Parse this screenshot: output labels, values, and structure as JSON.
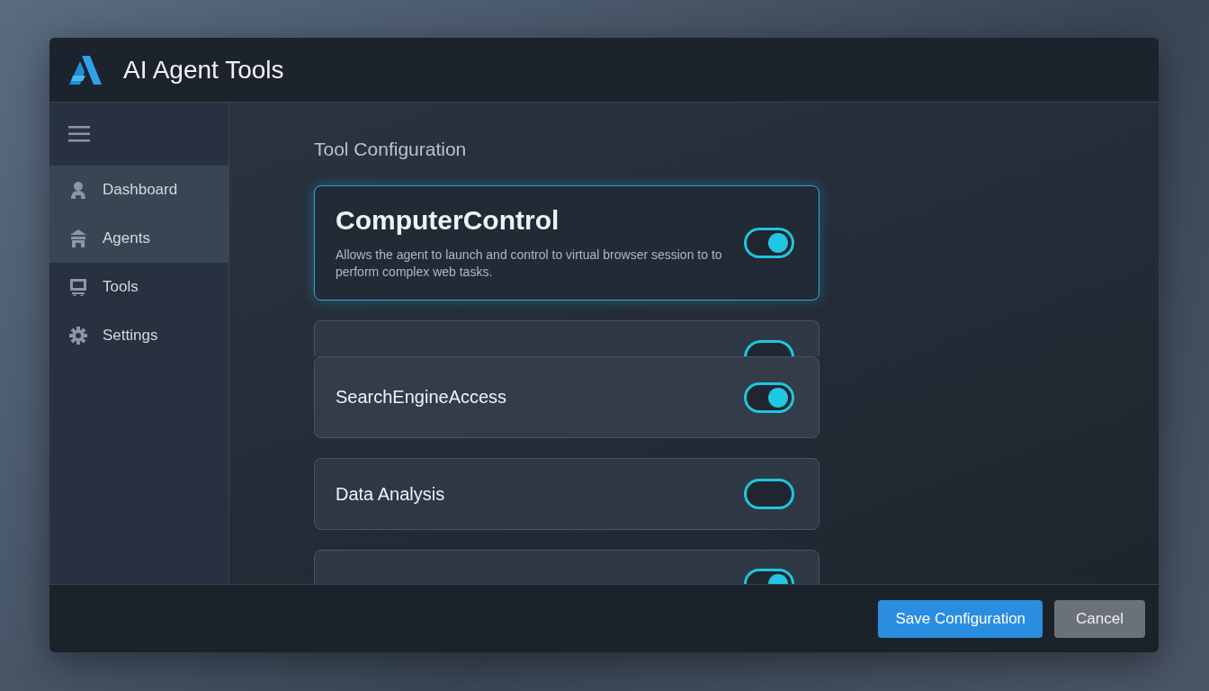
{
  "window": {
    "title": "AI Agent Tools"
  },
  "sidebar": {
    "items": [
      {
        "label": "Dashboard",
        "selected": true
      },
      {
        "label": "Agents",
        "selected": true
      },
      {
        "label": "Tools",
        "selected": false
      },
      {
        "label": "Settings",
        "selected": false
      }
    ]
  },
  "section_title": "Tool Configuration",
  "tools": [
    {
      "kind": "featured",
      "name": "ComputerControl",
      "description": "Allows the agent to launch and control to virtual browser session to to perform complex web tasks.",
      "on": true
    },
    {
      "kind": "covered",
      "on": false
    },
    {
      "kind": "raised",
      "name": "SearchEngineAccess",
      "on": true
    },
    {
      "kind": "plain",
      "name": "Data Analysis",
      "on": false
    },
    {
      "kind": "clipped",
      "on": true
    }
  ],
  "buttons": [
    {
      "label": "Save Configuration",
      "kind": "primary"
    },
    {
      "label": "Cancel",
      "kind": "secondary"
    }
  ]
}
